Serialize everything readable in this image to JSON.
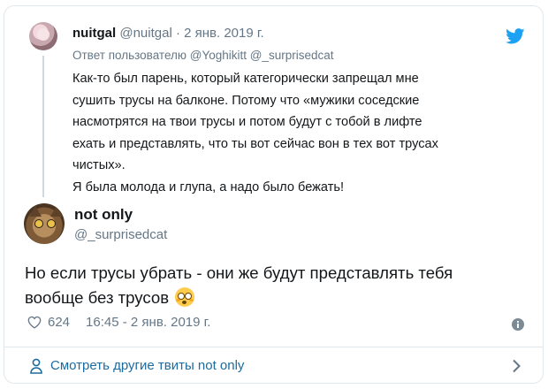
{
  "parent_tweet": {
    "display_name": "nuitgal",
    "handle": "@nuitgal",
    "separator": " · ",
    "date": "2 янв. 2019 г.",
    "reply_to": "Ответ пользователю @Yoghikitt @_surprisedcat",
    "lines": [
      "Как-то был парень, который категорически запрещал мне",
      "сушить трусы на балконе. Потому что «мужики соседские",
      "насмотрятся на твои  трусы и потом будут с тобой в лифте",
      "ехать и представлять, что ты вот сейчас вон в тех вот трусах",
      "чистых».",
      "Я была молода и глупа, а надо было бежать!"
    ]
  },
  "main_tweet": {
    "display_name": "not only",
    "handle": "@_surprisedcat",
    "text_line1": "Но если трусы убрать - они же будут представлять тебя",
    "text_line2": "вообще без трусов",
    "emoji": "flushed-face",
    "likes": "624",
    "timestamp": "16:45 - 2 янв. 2019 г."
  },
  "footer": {
    "more_link": "Смотреть другие твиты not only"
  },
  "colors": {
    "twitter_blue": "#1da1f2",
    "link_blue": "#1b6b9f",
    "muted": "#657786",
    "text": "#14171a",
    "border": "#e1e8ed"
  },
  "icons": [
    "twitter-bird-icon",
    "heart-icon",
    "info-icon",
    "person-icon",
    "chevron-right-icon"
  ]
}
